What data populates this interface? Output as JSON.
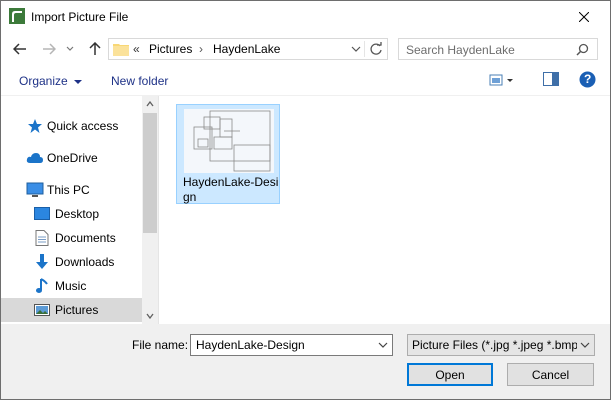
{
  "window": {
    "title": "Import Picture File",
    "close_glyph": "✕"
  },
  "nav": {
    "back_icon": "arrow-left-icon",
    "forward_icon": "arrow-right-icon",
    "recent_icon": "chevron-down-icon",
    "up_icon": "arrow-up-icon"
  },
  "address": {
    "overflow": "«",
    "crumbs": [
      "Pictures",
      "HaydenLake"
    ],
    "separator": "›"
  },
  "search": {
    "placeholder": "Search HaydenLake"
  },
  "toolbar": {
    "organize_label": "Organize",
    "new_folder_label": "New folder",
    "help_label": "?"
  },
  "sidebar": {
    "items": [
      {
        "label": "Quick access",
        "icon": "star-icon"
      },
      {
        "label": "OneDrive",
        "icon": "cloud-icon"
      },
      {
        "label": "This PC",
        "icon": "computer-icon"
      },
      {
        "label": "Desktop",
        "icon": "desktop-icon"
      },
      {
        "label": "Documents",
        "icon": "document-icon"
      },
      {
        "label": "Downloads",
        "icon": "download-icon"
      },
      {
        "label": "Music",
        "icon": "music-icon"
      },
      {
        "label": "Pictures",
        "icon": "pictures-icon",
        "selected": true
      }
    ]
  },
  "files": [
    {
      "name": "HaydenLake-Design",
      "icon": "floorplan-thumbnail"
    }
  ],
  "bottom": {
    "file_name_label": "File name:",
    "file_name_value": "HaydenLake-Design",
    "filter_value": "Picture Files (*.jpg *.jpeg *.bmp",
    "open_label": "Open",
    "cancel_label": "Cancel"
  },
  "colors": {
    "accent": "#0078d7",
    "selection": "#cce8ff",
    "link": "#1e3287"
  }
}
